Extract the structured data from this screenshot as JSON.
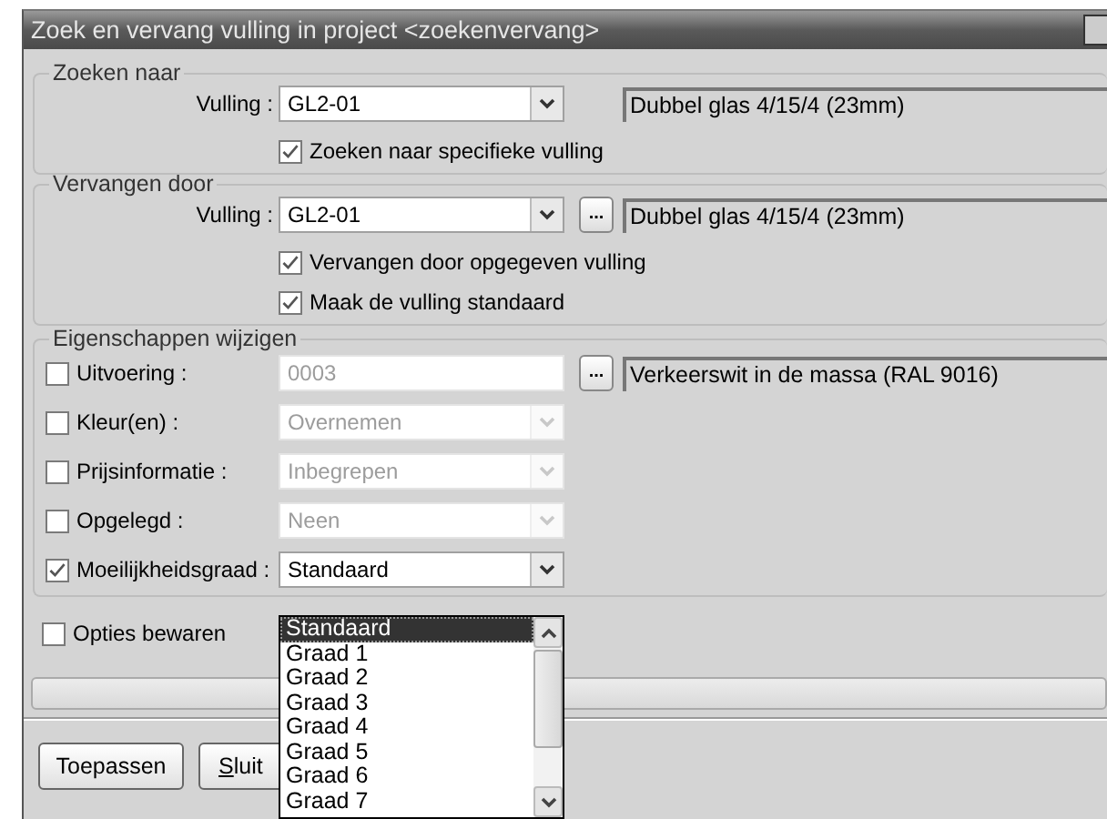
{
  "window": {
    "title": "Zoek en vervang vulling in project <zoekenvervang>"
  },
  "search_group": {
    "legend": "Zoeken naar",
    "label": "Vulling :",
    "value": "GL2-01",
    "description": "Dubbel glas 4/15/4 (23mm)",
    "checkbox": {
      "label": "Zoeken naar specifieke vulling",
      "checked": true
    }
  },
  "replace_group": {
    "legend": "Vervangen door",
    "label": "Vulling :",
    "value": "GL2-01",
    "browse": "...",
    "description": "Dubbel glas 4/15/4 (23mm)",
    "checkboxes": [
      {
        "label": "Vervangen door opgegeven vulling",
        "checked": true
      },
      {
        "label": "Maak de vulling standaard",
        "checked": true
      }
    ]
  },
  "properties_group": {
    "legend": "Eigenschappen wijzigen",
    "rows": [
      {
        "kind": "text",
        "label": "Uitvoering :",
        "checked": false,
        "value": "0003",
        "browse": "...",
        "description": "Verkeerswit in de massa (RAL 9016)"
      },
      {
        "kind": "combo",
        "label": "Kleur(en) :",
        "checked": false,
        "value": "Overnemen",
        "expanded": false
      },
      {
        "kind": "combo",
        "label": "Prijsinformatie :",
        "checked": false,
        "value": "Inbegrepen",
        "expanded": false
      },
      {
        "kind": "combo",
        "label": "Opgelegd :",
        "checked": false,
        "value": "Neen",
        "expanded": false
      },
      {
        "kind": "combo",
        "label": "Moeilijkheidsgraad :",
        "checked": true,
        "value": "Standaard",
        "expanded": true,
        "options": [
          {
            "label": "Standaard",
            "selected": true
          },
          {
            "label": "Graad 1",
            "selected": false
          },
          {
            "label": "Graad 2",
            "selected": false
          },
          {
            "label": "Graad 3",
            "selected": false
          },
          {
            "label": "Graad 4",
            "selected": false
          },
          {
            "label": "Graad 5",
            "selected": false
          },
          {
            "label": "Graad 6",
            "selected": false
          },
          {
            "label": "Graad 7",
            "selected": false
          }
        ]
      }
    ]
  },
  "save_options": {
    "label": "Opties bewaren",
    "checked": false
  },
  "buttons": [
    {
      "label": "Toepassen"
    },
    {
      "label": "Sluit"
    }
  ]
}
